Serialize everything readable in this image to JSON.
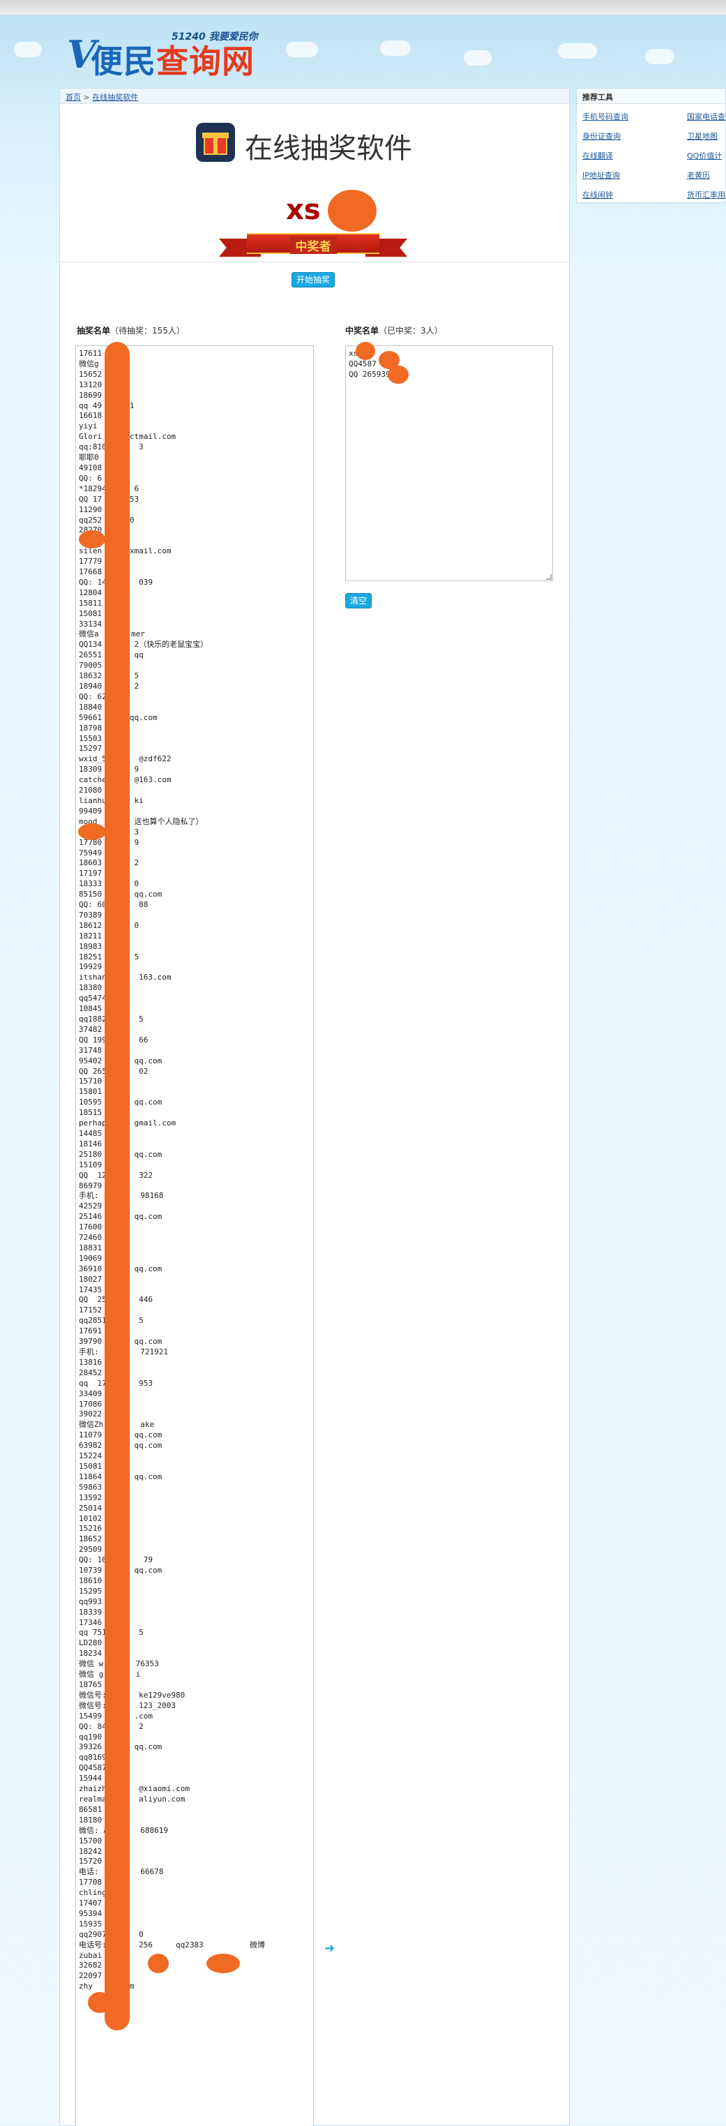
{
  "site": {
    "logo_text": "便民查询网",
    "logo_mark": "V",
    "logo_main": "便民",
    "logo_red": "查询网",
    "slogan": "51240 我要爱民你"
  },
  "breadcrumb": {
    "home": "首页",
    "sep": ">",
    "current": "在线抽奖软件"
  },
  "page": {
    "title": "在线抽奖软件",
    "icon": "gift-icon"
  },
  "winner": {
    "name": "xs",
    "banner": "中奖者",
    "start_button": "开始抽奖"
  },
  "list": {
    "label": "抽奖名单",
    "count_text": "（待抽奖：155人）",
    "lines": [
      "17611",
      "微信g",
      "15652",
      "13120",
      "18699",
      "qq 49      1",
      "16618",
      "yiyi      7",
      "Glori      ctmail.com",
      "qq:810       3",
      "耶耶0",
      "49108",
      "QQ: 6",
      "*18294      6",
      "QQ 17      53",
      "11290",
      "qq252      0",
      "28270",
      "",
      "18515",
      "silen      xmail.com",
      "17779",
      "17668",
      "QQ: 14       039",
      "12804",
      "15811",
      "15081",
      "33134",
      "微信a       mer",
      "QQ134       2（快乐的老鼠宝宝）",
      "26551       qq",
      "79005",
      "18632       5",
      "18940       2",
      "QQ: 62",
      "18840       ",
      "59661      qq.com",
      "18798",
      "15503",
      "15297",
      "wxid_5       @zdf622",
      "18309       9",
      "catche      @163.com",
      "21080",
      "lianhu      ki",
      "99409",
      "mood        这也算个人隐私了）",
      "13649       3",
      "17780       9",
      "75949",
      "18603       2",
      "17197",
      "18333       0",
      "85150       qq.com",
      "QQ: 60       88",
      "70389",
      "18612       0",
      "18211       ",
      "18983",
      "18251       5",
      "19929",
      "itshan       163.com",
      "18380",
      "qq5474",
      "10845",
      "qq1882       5",
      "37482",
      "QQ 199       66",
      "31748",
      "95402       qq.com",
      "QQ 265       02",
      "15710",
      "15801",
      "10595       qq.com",
      "18515",
      "perhap      gmail.com",
      "14485",
      "18146",
      "25180       qq.com",
      "15109",
      "QQ  12       322",
      "86979",
      "手机: 1       98168",
      "42529",
      "25146       qq.com",
      "17600",
      "72460",
      "18831",
      "19069",
      "36910       qq.com",
      "18027",
      "17435",
      "QQ  25       446",
      "17152",
      "qq2851       5",
      "17691",
      "39790       qq.com",
      "手机: 1       721921",
      "13816",
      "28452",
      "qq  17       953",
      "33409",
      "17086",
      "39022",
      "微信Zh        ake",
      "11079       qq.com",
      "63982       qq.com",
      "15224",
      "15081",
      "11864       qq.com",
      "59863",
      "13592",
      "25014",
      "10102",
      "15216",
      "18652",
      "29509",
      "QQ: 101       79",
      "10739       qq.com",
      "18610",
      "15295",
      "qq993",
      "18339",
      "17346",
      "qq 751       5",
      "LD280",
      "18234",
      "微信 w       76353",
      "微信 g       i",
      "18765",
      "微信号:       ke129ve980",
      "微信号:       123_2003",
      "15499       .com",
      "QQ: 84       2",
      "qq190",
      "39326       qq.com",
      "qq8169",
      "QQ4587",
      "15944",
      "zhaizh       @xiaomi.com",
      "realma       aliyun.com",
      "86581",
      "18180",
      "微信: a       688619",
      "15700",
      "18242",
      "15720",
      "电话: 1       66678",
      "17708",
      "chling",
      "17407",
      "95394",
      "15935",
      "qq2907       0",
      "电话号:       256     qq2383          微博",
      "zubai",
      "32682",
      "22097",
      "zhy       om"
    ]
  },
  "result": {
    "label": "中奖名单",
    "count_text": "（已中奖：3人）",
    "lines": [
      "xs",
      "QQ4587",
      "QQ 265939"
    ],
    "clear_button": "清空"
  },
  "sidebar": {
    "heading": "推荐工具",
    "items": [
      "手机号码查询",
      "国家电话查",
      "身份证查询",
      "卫星地图",
      "在线翻译",
      "QQ价值计",
      "IP地址查询",
      "老黄历",
      "在线闹钟",
      "货币汇率用"
    ]
  }
}
